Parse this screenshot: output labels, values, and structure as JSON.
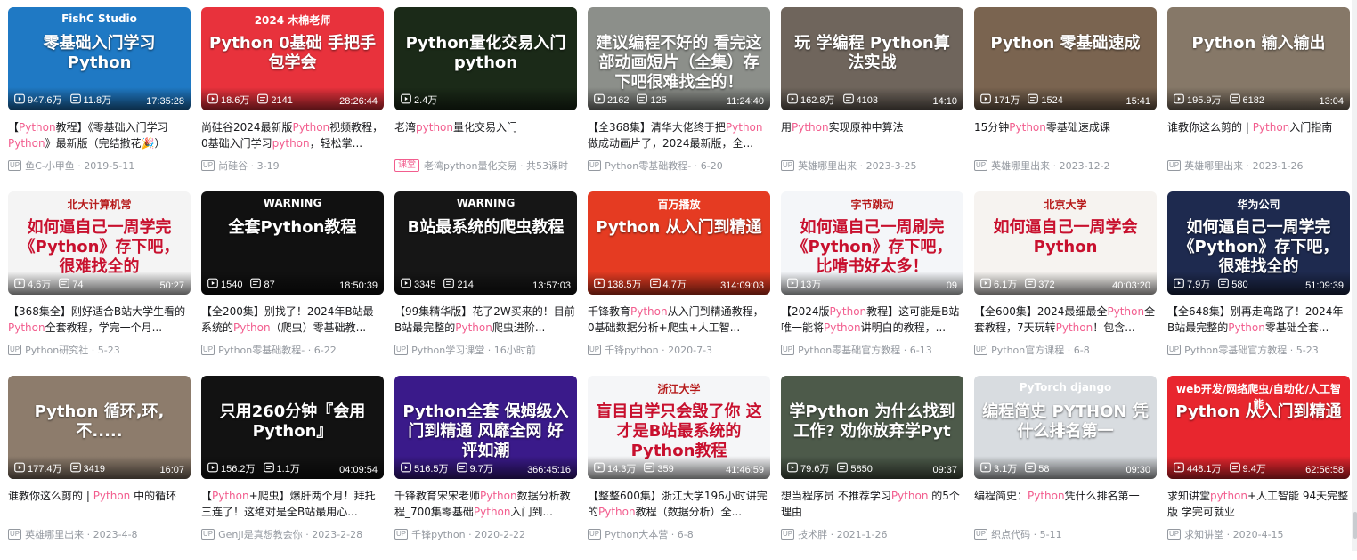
{
  "cards": [
    {
      "thumb_text": "零基础入门学习Python",
      "thumb_sub": "FishC Studio",
      "bg": "#1f79c4",
      "views": "947.6万",
      "danmaku": "11.8万",
      "duration": "17:35:28",
      "title": [
        [
          "【",
          ""
        ],
        [
          "Python",
          "kw"
        ],
        [
          "教程】《零基础入门学习",
          ""
        ],
        [
          "P",
          "kw"
        ],
        [
          "ython",
          "kw"
        ],
        [
          "》最新版（完结撒花🎉）",
          ""
        ]
      ],
      "author": "鱼C-小甲鱼",
      "date": "2019-5-11"
    },
    {
      "thumb_text": "Python 0基础 手把手 包学会",
      "thumb_sub": "2024 木棉老师",
      "bg": "#e8323c",
      "views": "18.6万",
      "danmaku": "2141",
      "duration": "28:26:44",
      "title": [
        [
          "尚硅谷2024最新版",
          ""
        ],
        [
          "Python",
          "kw"
        ],
        [
          "视频教程，0基础入门学习",
          ""
        ],
        [
          "python",
          "kw"
        ],
        [
          "，轻松掌...",
          ""
        ]
      ],
      "author": "尚硅谷",
      "date": "3-19"
    },
    {
      "thumb_text": "Python量化交易入门 python",
      "thumb_sub": "",
      "bg": "#1b2a18",
      "views": "2.4万",
      "danmaku": "",
      "duration": "",
      "title": [
        [
          "老湾",
          ""
        ],
        [
          "python",
          "kw"
        ],
        [
          "量化交易入门",
          ""
        ]
      ],
      "author": "老湾python量化交易",
      "date": "共53课时",
      "course": "课堂"
    },
    {
      "thumb_text": "建议编程不好的 看完这部动画短片（全集）存下吧很难找全的！",
      "thumb_sub": "",
      "bg": "#8c8f8a",
      "views": "2162",
      "danmaku": "125",
      "duration": "11:24:40",
      "title": [
        [
          "【全368集】清华大佬终于把",
          ""
        ],
        [
          "Python",
          "kw"
        ],
        [
          "做成动画片了，2024最新版，全...",
          ""
        ]
      ],
      "author": "Python零基础教程-",
      "date": "6-20"
    },
    {
      "thumb_text": "玩 学编程 Python算法实战",
      "thumb_sub": "",
      "bg": "#6f655c",
      "views": "162.8万",
      "danmaku": "4103",
      "duration": "14:10",
      "title": [
        [
          "用",
          ""
        ],
        [
          "Python",
          "kw"
        ],
        [
          "实现原神中算法",
          ""
        ]
      ],
      "author": "英雄哪里出来",
      "date": "2023-3-25"
    },
    {
      "thumb_text": "Python 零基础速成",
      "thumb_sub": "",
      "bg": "#7a6450",
      "views": "171万",
      "danmaku": "1524",
      "duration": "15:41",
      "title": [
        [
          "15分钟",
          ""
        ],
        [
          "Python",
          "kw"
        ],
        [
          "零基础速成课",
          ""
        ]
      ],
      "author": "英雄哪里出来",
      "date": "2023-12-2"
    },
    {
      "thumb_text": "Python 输入输出",
      "thumb_sub": "",
      "bg": "#867868",
      "views": "195.9万",
      "danmaku": "6182",
      "duration": "13:04",
      "title": [
        [
          "谁教你这么剪的 | ",
          ""
        ],
        [
          "Python",
          "kw"
        ],
        [
          "入门指南",
          ""
        ]
      ],
      "author": "英雄哪里出来",
      "date": "2023-1-26"
    },
    {
      "thumb_text": "如何逼自己一周学完《Python》存下吧，很难找全的",
      "thumb_sub": "北大计算机常",
      "bg": "#f4f4f4",
      "views": "4.6万",
      "danmaku": "74",
      "duration": "50:27",
      "title": [
        [
          "【368集全】刚好适合B站大学生看的",
          ""
        ],
        [
          "Python",
          "kw"
        ],
        [
          "全套教程，学完一个月...",
          ""
        ]
      ],
      "author": "Python研究社",
      "date": "5-23",
      "dark": true
    },
    {
      "thumb_text": "全套Python教程",
      "thumb_sub": "WARNING",
      "bg": "#111111",
      "views": "1540",
      "danmaku": "87",
      "duration": "18:50:39",
      "title": [
        [
          "【全200集】别找了！2024年B站最系统的",
          ""
        ],
        [
          "Python",
          "kw"
        ],
        [
          "（爬虫）零基础教...",
          ""
        ]
      ],
      "author": "Python零基础教程-",
      "date": "6-22"
    },
    {
      "thumb_text": "B站最系统的爬虫教程",
      "thumb_sub": "WARNING",
      "bg": "#161616",
      "views": "3345",
      "danmaku": "214",
      "duration": "13:57:03",
      "title": [
        [
          "【99集精华版】花了2W买来的！目前B站最完整的",
          ""
        ],
        [
          "Python",
          "kw"
        ],
        [
          "爬虫进阶...",
          ""
        ]
      ],
      "author": "Python学习课堂",
      "date": "16小时前"
    },
    {
      "thumb_text": "Python 从入门到精通",
      "thumb_sub": "百万播放",
      "bg": "#e53b22",
      "views": "138.5万",
      "danmaku": "4.7万",
      "duration": "314:09:03",
      "title": [
        [
          "千锋教育",
          ""
        ],
        [
          "Python",
          "kw"
        ],
        [
          "从入门到精通教程，0基础数据分析+爬虫+人工智...",
          ""
        ]
      ],
      "author": "千锋python",
      "date": "2020-7-3"
    },
    {
      "thumb_text": "如何逼自己一周刷完《Python》存下吧，比啃书好太多！",
      "thumb_sub": "字节跳动",
      "bg": "#f4f6f9",
      "views": "13万",
      "danmaku": "",
      "duration": "09",
      "title": [
        [
          "【2024版",
          ""
        ],
        [
          "Python",
          "kw"
        ],
        [
          "教程】这可能是B站唯一能将",
          ""
        ],
        [
          "Python",
          "kw"
        ],
        [
          "讲明白的教程，...",
          ""
        ]
      ],
      "author": "Python零基础官方教程",
      "date": "6-13",
      "dark": true
    },
    {
      "thumb_text": "如何逼自己一周学会Python",
      "thumb_sub": "北京大学",
      "bg": "#f6f3f0",
      "views": "6.1万",
      "danmaku": "372",
      "duration": "40:03:20",
      "title": [
        [
          "【全600集】2024最细最全",
          ""
        ],
        [
          "Python",
          "kw"
        ],
        [
          "全套教程，7天玩转",
          ""
        ],
        [
          "Python",
          "kw"
        ],
        [
          "！包含...",
          ""
        ]
      ],
      "author": "Python官方课程",
      "date": "6-8",
      "dark": true
    },
    {
      "thumb_text": "如何逼自己一周学完《Python》存下吧，很难找全的",
      "thumb_sub": "华为公司",
      "bg": "#1e2a4f",
      "views": "7.9万",
      "danmaku": "580",
      "duration": "51:09:39",
      "title": [
        [
          "【全648集】别再走弯路了！2024年B站最完整的",
          ""
        ],
        [
          "Python",
          "kw"
        ],
        [
          "零基础全套...",
          ""
        ]
      ],
      "author": "Python零基础官方教程",
      "date": "5-23"
    },
    {
      "thumb_text": "Python 循环,环,不.....",
      "thumb_sub": "",
      "bg": "#8d7c6c",
      "views": "177.4万",
      "danmaku": "3419",
      "duration": "16:07",
      "title": [
        [
          "谁教你这么剪的 | ",
          ""
        ],
        [
          "Python",
          "kw"
        ],
        [
          " 中的循环",
          ""
        ]
      ],
      "author": "英雄哪里出来",
      "date": "2023-4-8"
    },
    {
      "thumb_text": "只用260分钟『会用 Python』",
      "thumb_sub": "",
      "bg": "#121212",
      "views": "156.2万",
      "danmaku": "1.1万",
      "duration": "04:09:54",
      "title": [
        [
          "【",
          ""
        ],
        [
          "Python",
          "kw"
        ],
        [
          "+爬虫】爆肝两个月！拜托三连了！这绝对是全B站最用心...",
          ""
        ]
      ],
      "author": "GenJi是真想教会你",
      "date": "2023-2-28"
    },
    {
      "thumb_text": "Python全套 保姆级入门到精通 风靡全网 好评如潮",
      "thumb_sub": "",
      "bg": "#3a1a8a",
      "views": "516.5万",
      "danmaku": "9.7万",
      "duration": "366:45:16",
      "title": [
        [
          "千锋教育宋宋老师",
          ""
        ],
        [
          "Python",
          "kw"
        ],
        [
          "数据分析教程_700集零基础",
          ""
        ],
        [
          "Python",
          "kw"
        ],
        [
          "入门到...",
          ""
        ]
      ],
      "author": "千锋python",
      "date": "2020-2-22"
    },
    {
      "thumb_text": "盲目自学只会毁了你 这才是B站最系统的 Python教程",
      "thumb_sub": "浙江大学",
      "bg": "#f5f6f8",
      "views": "14.3万",
      "danmaku": "359",
      "duration": "41:46:59",
      "title": [
        [
          "【整整600集】浙江大学196小时讲完的",
          ""
        ],
        [
          "Python",
          "kw"
        ],
        [
          "教程（数据分析）全...",
          ""
        ]
      ],
      "author": "Python大本营",
      "date": "6-8",
      "dark": true
    },
    {
      "thumb_text": "学Python 为什么找到工作? 劝你放弃学Pyt",
      "thumb_sub": "",
      "bg": "#4d5a4a",
      "views": "79.6万",
      "danmaku": "5850",
      "duration": "09:37",
      "title": [
        [
          "想当程序员 不推荐学习",
          ""
        ],
        [
          "Python",
          "kw"
        ],
        [
          " 的5个理由",
          ""
        ]
      ],
      "author": "技术胖",
      "date": "2021-1-26"
    },
    {
      "thumb_text": "编程简史 PYTHON 凭什么排名第一",
      "thumb_sub": "PyTorch django",
      "bg": "#d8dce0",
      "views": "3.1万",
      "danmaku": "58",
      "duration": "09:30",
      "title": [
        [
          "编程简史：",
          ""
        ],
        [
          "Python",
          "kw"
        ],
        [
          "凭什么排名第一",
          ""
        ]
      ],
      "author": "织点代码",
      "date": "5-11"
    },
    {
      "thumb_text": "Python 从入门到精通",
      "thumb_sub": "web开发/网络爬虫/自动化/人工智能",
      "bg": "#e8262e",
      "views": "448.1万",
      "danmaku": "9.4万",
      "duration": "62:56:58",
      "title": [
        [
          "求知讲堂",
          ""
        ],
        [
          "python",
          "kw"
        ],
        [
          "+人工智能 94天完整版 学完可就业",
          ""
        ]
      ],
      "author": "求知讲堂",
      "date": "2020-4-15"
    }
  ],
  "labels": {
    "up": "UP"
  }
}
